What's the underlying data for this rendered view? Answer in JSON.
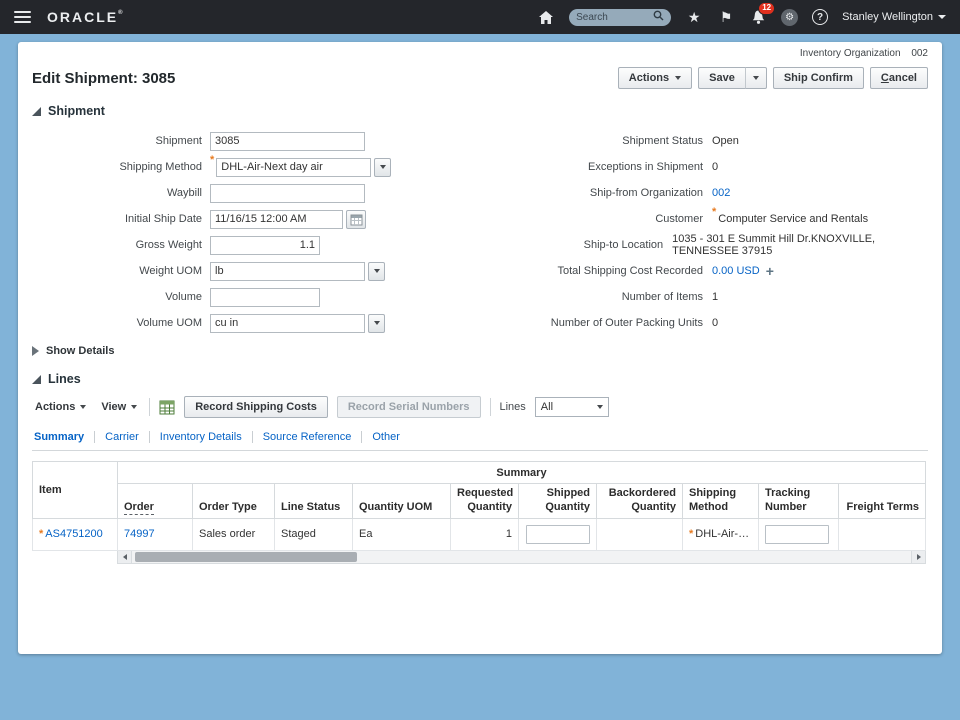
{
  "topbar": {
    "brand": "ORACLE",
    "brand_mark": "®",
    "search_placeholder": "Search",
    "notification_count": "12",
    "user_name": "Stanley Wellington"
  },
  "icons": {
    "star": "★",
    "flag": "⚑",
    "gear": "⚙",
    "help": "?",
    "plus": "+"
  },
  "ui": {
    "required_marker": "*"
  },
  "context": {
    "label": "Inventory Organization",
    "value": "002"
  },
  "page": {
    "title": "Edit Shipment: 3085",
    "buttons": {
      "actions": "Actions",
      "save": "Save",
      "ship_confirm": "Ship Confirm",
      "cancel": "Cancel"
    }
  },
  "shipment": {
    "title": "Shipment",
    "show_details": "Show Details",
    "fields_left": [
      {
        "label": "Shipment",
        "value": "3085"
      },
      {
        "label": "Shipping Method",
        "value": "DHL-Air-Next day air",
        "required": true
      },
      {
        "label": "Waybill",
        "value": ""
      },
      {
        "label": "Initial Ship Date",
        "value": "11/16/15 12:00 AM"
      },
      {
        "label": "Gross Weight",
        "value": "1.1"
      },
      {
        "label": "Weight UOM",
        "value": "lb"
      },
      {
        "label": "Volume",
        "value": ""
      },
      {
        "label": "Volume UOM",
        "value": "cu in"
      }
    ],
    "fields_right": [
      {
        "label": "Shipment Status",
        "value": "Open"
      },
      {
        "label": "Exceptions in Shipment",
        "value": "0"
      },
      {
        "label": "Ship-from Organization",
        "value": "002"
      },
      {
        "label": "Customer",
        "value": "Computer Service and Rentals",
        "required": true
      },
      {
        "label": "Ship-to Location",
        "value": "1035 - 301 E Summit Hill Dr.KNOXVILLE, TENNESSEE 37915"
      },
      {
        "label": "Total Shipping Cost Recorded",
        "value": "0.00 USD"
      },
      {
        "label": "Number of Items",
        "value": "1"
      },
      {
        "label": "Number of Outer Packing Units",
        "value": "0"
      }
    ]
  },
  "lines": {
    "title": "Lines",
    "toolbar": {
      "actions": "Actions",
      "view": "View",
      "record_shipping_costs": "Record Shipping Costs",
      "record_serial_numbers": "Record Serial Numbers",
      "lines_label": "Lines",
      "filter_value": "All"
    },
    "tabs": [
      "Summary",
      "Carrier",
      "Inventory Details",
      "Source Reference",
      "Other"
    ],
    "table": {
      "group_header": "Summary",
      "item_header": "Item",
      "columns": [
        "Order",
        "Order Type",
        "Line Status",
        "Quantity UOM",
        "Requested Quantity",
        "Shipped Quantity",
        "Backordered Quantity",
        "Shipping Method",
        "Tracking Number",
        "Freight Terms"
      ],
      "rows": [
        {
          "item": "AS4751200",
          "order": "74997",
          "order_type": "Sales order",
          "line_status": "Staged",
          "quantity_uom": "Ea",
          "requested_quantity": "1",
          "shipped_quantity": "",
          "backordered_quantity": "",
          "shipping_method": "DHL-Air-Next ...",
          "tracking_number": "",
          "freight_terms": ""
        }
      ]
    }
  }
}
